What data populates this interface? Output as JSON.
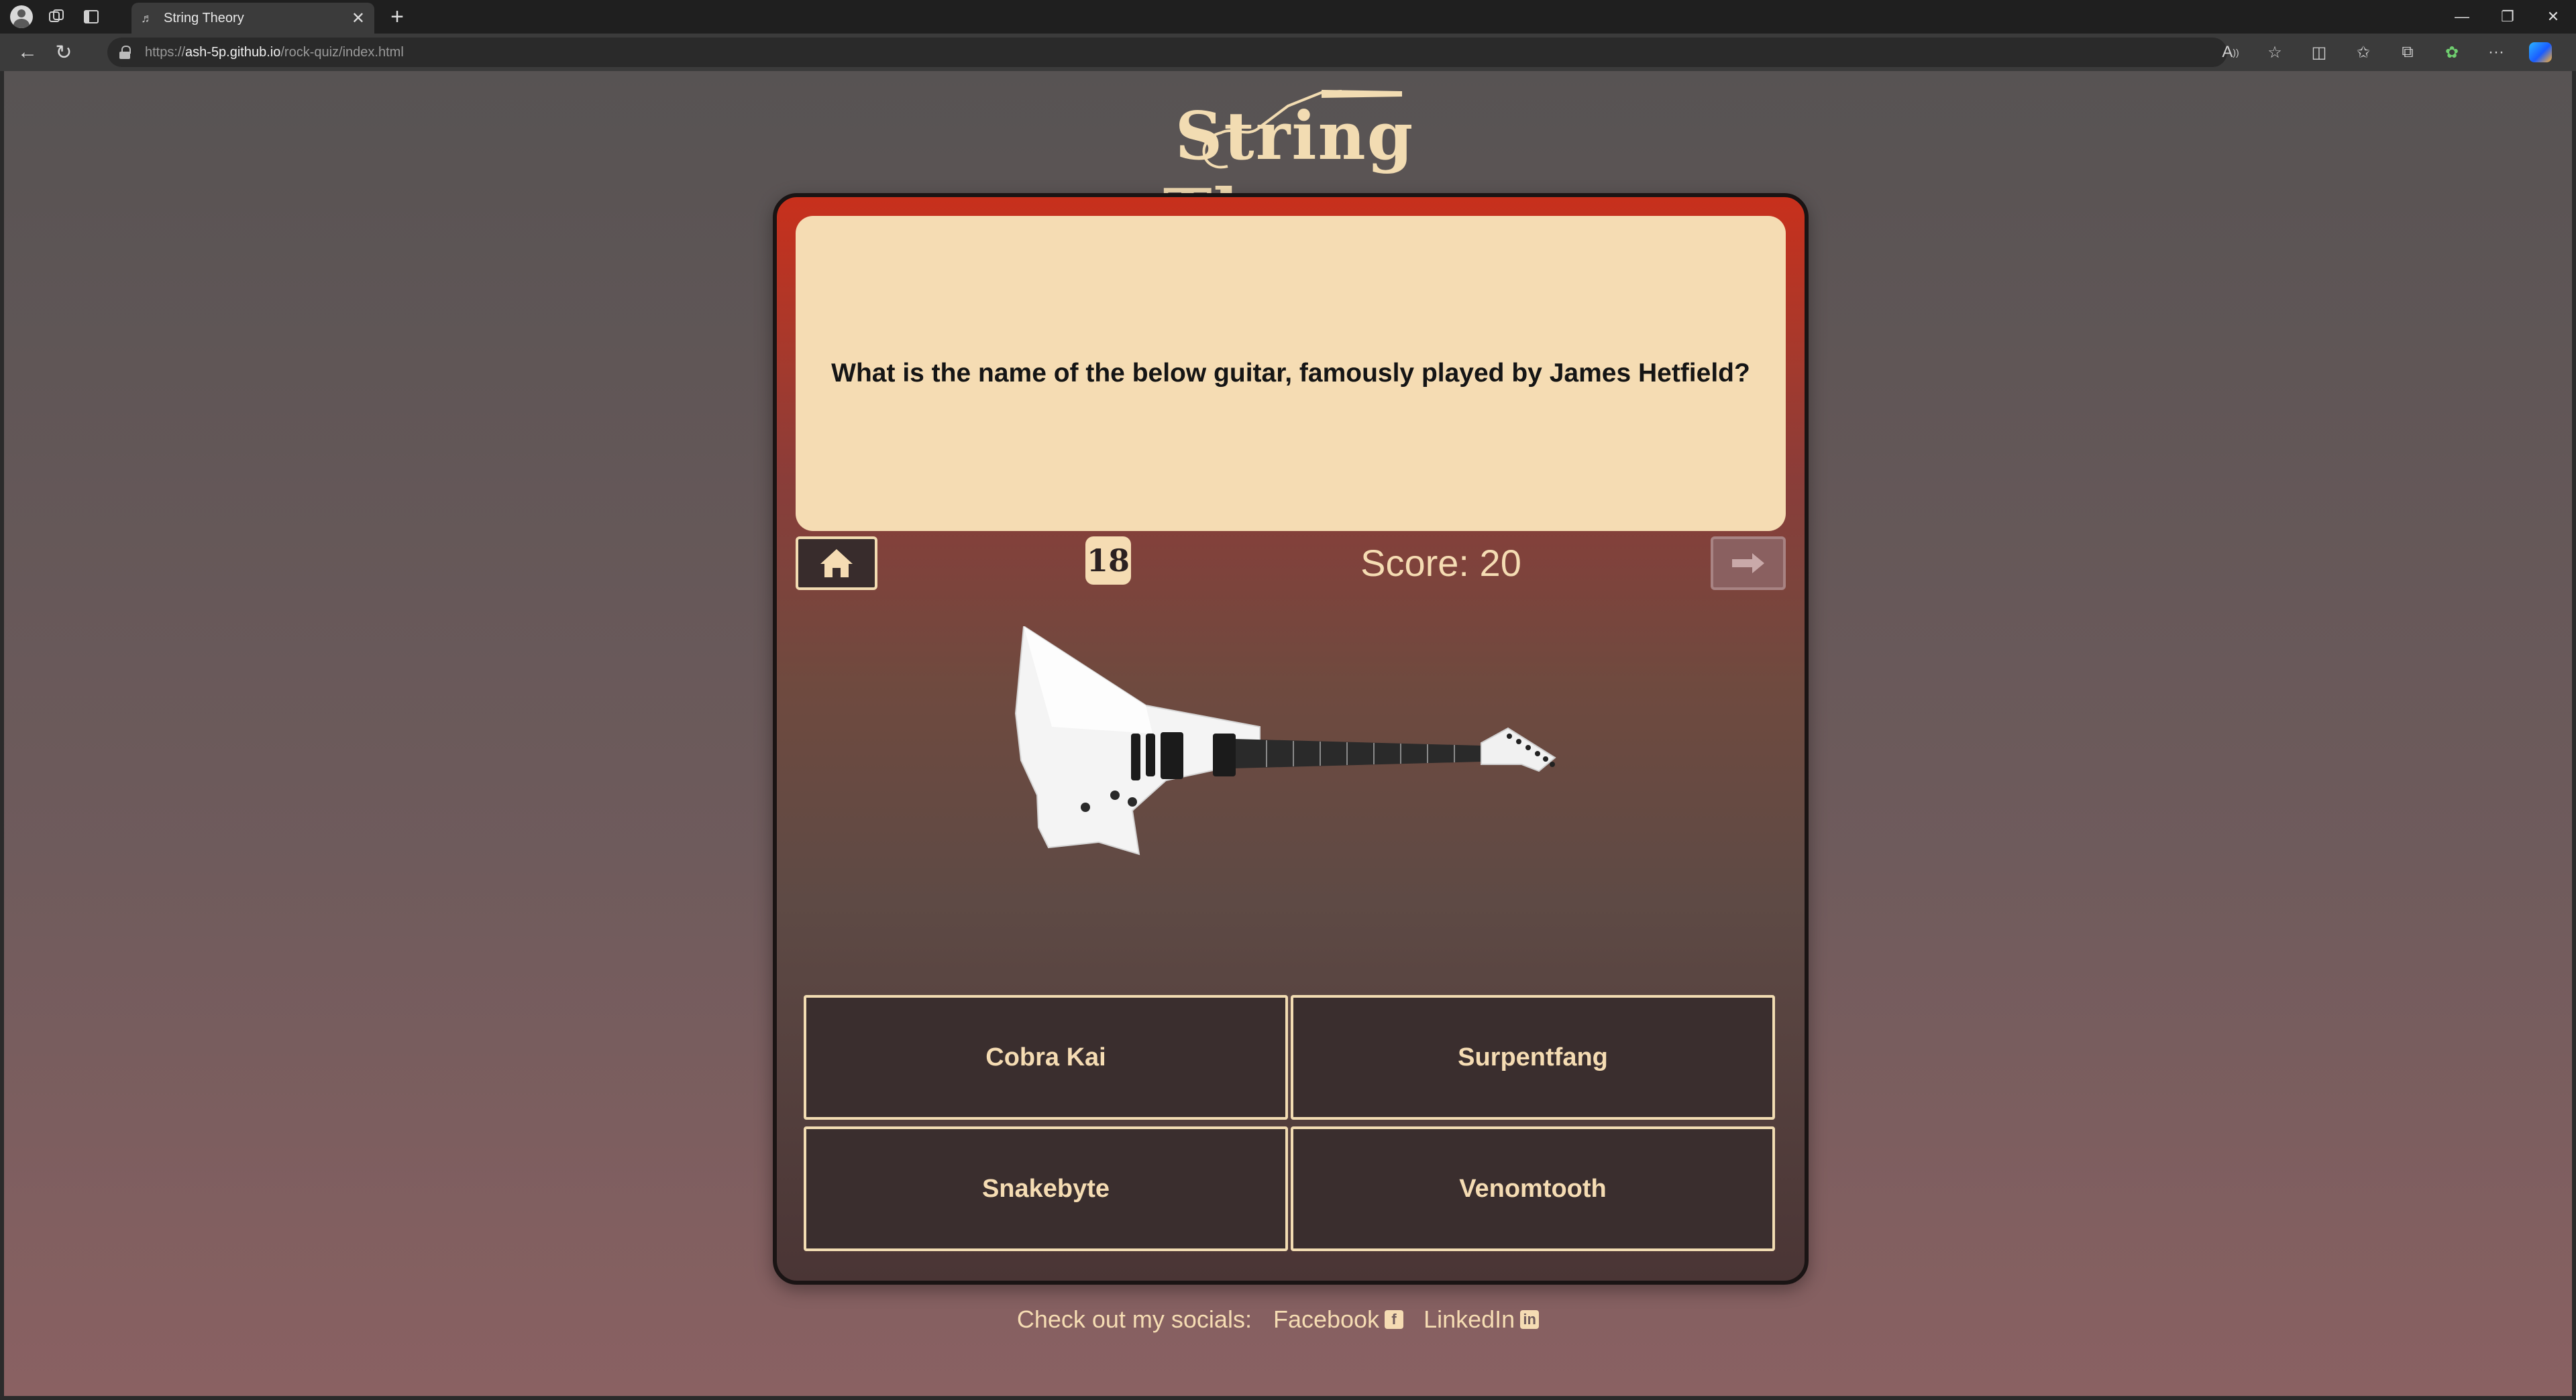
{
  "browser": {
    "tab_title": "String Theory",
    "url_scheme": "https://",
    "url_host": "ash-5p.github.io",
    "url_path": "/rock-quiz/index.html"
  },
  "site": {
    "logo_text": "String Theory"
  },
  "quiz": {
    "question": "What is the name of the below guitar, famously played by James Hetfield?",
    "question_number": "18",
    "score_label": "Score: 20",
    "answers": [
      {
        "label": "Cobra Kai"
      },
      {
        "label": "Surpentfang"
      },
      {
        "label": "Snakebyte"
      },
      {
        "label": "Venomtooth"
      }
    ]
  },
  "footer": {
    "label": "Check out my socials:",
    "facebook": "Facebook",
    "linkedin": "LinkedIn"
  },
  "colors": {
    "cream": "#f5dcb3",
    "card_top": "#c8301c",
    "button_bg": "#3a2e2e"
  }
}
